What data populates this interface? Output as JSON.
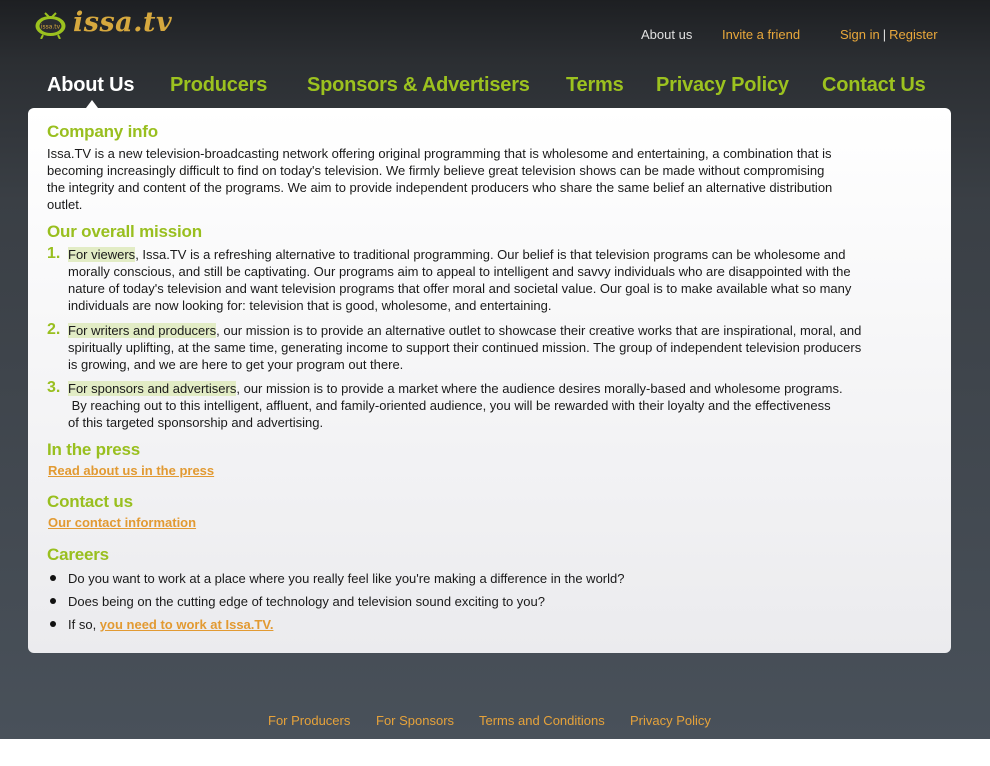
{
  "header": {
    "logo_text": "issa.tv",
    "logo_badge": "issa.tv",
    "links": {
      "about": "About us",
      "invite": "Invite a friend",
      "sign_in": "Sign in",
      "separator": "|",
      "register": "Register"
    }
  },
  "nav": {
    "items": [
      {
        "label": "About Us",
        "active": true
      },
      {
        "label": "Producers"
      },
      {
        "label": "Sponsors & Advertisers"
      },
      {
        "label": "Terms"
      },
      {
        "label": "Privacy Policy"
      },
      {
        "label": "Contact Us"
      }
    ]
  },
  "content": {
    "company": {
      "heading": "Company info",
      "lines": [
        "Issa.TV is a new television-broadcasting network offering original programming that is wholesome and entertaining, a combination that is",
        "becoming increasingly difficult to find on today's television. We firmly believe great television shows can be made without compromising",
        "the integrity and content of the programs. We aim to provide independent producers who share the same belief an alternative distribution",
        "outlet."
      ]
    },
    "mission": {
      "heading": "Our overall mission",
      "items": [
        {
          "number": "1.",
          "highlight": "For viewers",
          "first_rest": ", Issa.TV is a refreshing alternative to traditional programming. Our belief is that television programs can be wholesome and",
          "lines": [
            "morally conscious, and still be captivating. Our programs aim to appeal to intelligent and savvy individuals who are disappointed with the",
            "nature of today's television and want television programs that offer moral and societal value. Our goal is to make available what so many",
            "individuals are now looking for: television that is good, wholesome, and entertaining."
          ]
        },
        {
          "number": "2.",
          "highlight": "For writers and producers",
          "first_rest": ", our mission is to provide an alternative outlet to showcase their creative works that are inspirational, moral, and",
          "lines": [
            "spiritually uplifting, at the same time, generating income to support their continued mission.  The group of independent television producers",
            "is growing, and we are here to get your program out there."
          ]
        },
        {
          "number": "3.",
          "highlight": "For sponsors and advertisers",
          "first_rest": ", our mission is to provide a market where the audience desires morally-based and wholesome programs.",
          "lines": [
            " By reaching out to this intelligent, affluent, and family-oriented audience, you will be rewarded with their loyalty and the effectiveness",
            "of this targeted sponsorship and advertising."
          ]
        }
      ]
    },
    "press": {
      "heading": "In the press",
      "link": "Read about us in the press"
    },
    "contact": {
      "heading": "Contact us",
      "link": "Our contact information"
    },
    "careers": {
      "heading": "Careers",
      "bullets": [
        "Do you want to work at a place where you really feel like you're making a difference in the world?",
        "Does being on the cutting edge of technology and television sound exciting to you?"
      ],
      "last_prefix": "If so, ",
      "last_link": "you need to work at Issa.TV."
    }
  },
  "footer": {
    "links": [
      "For Producers",
      "For Sponsors",
      "Terms and Conditions",
      "Privacy Policy"
    ]
  },
  "colors": {
    "accent_green": "#99bf1f",
    "link_orange": "#e29a32"
  }
}
